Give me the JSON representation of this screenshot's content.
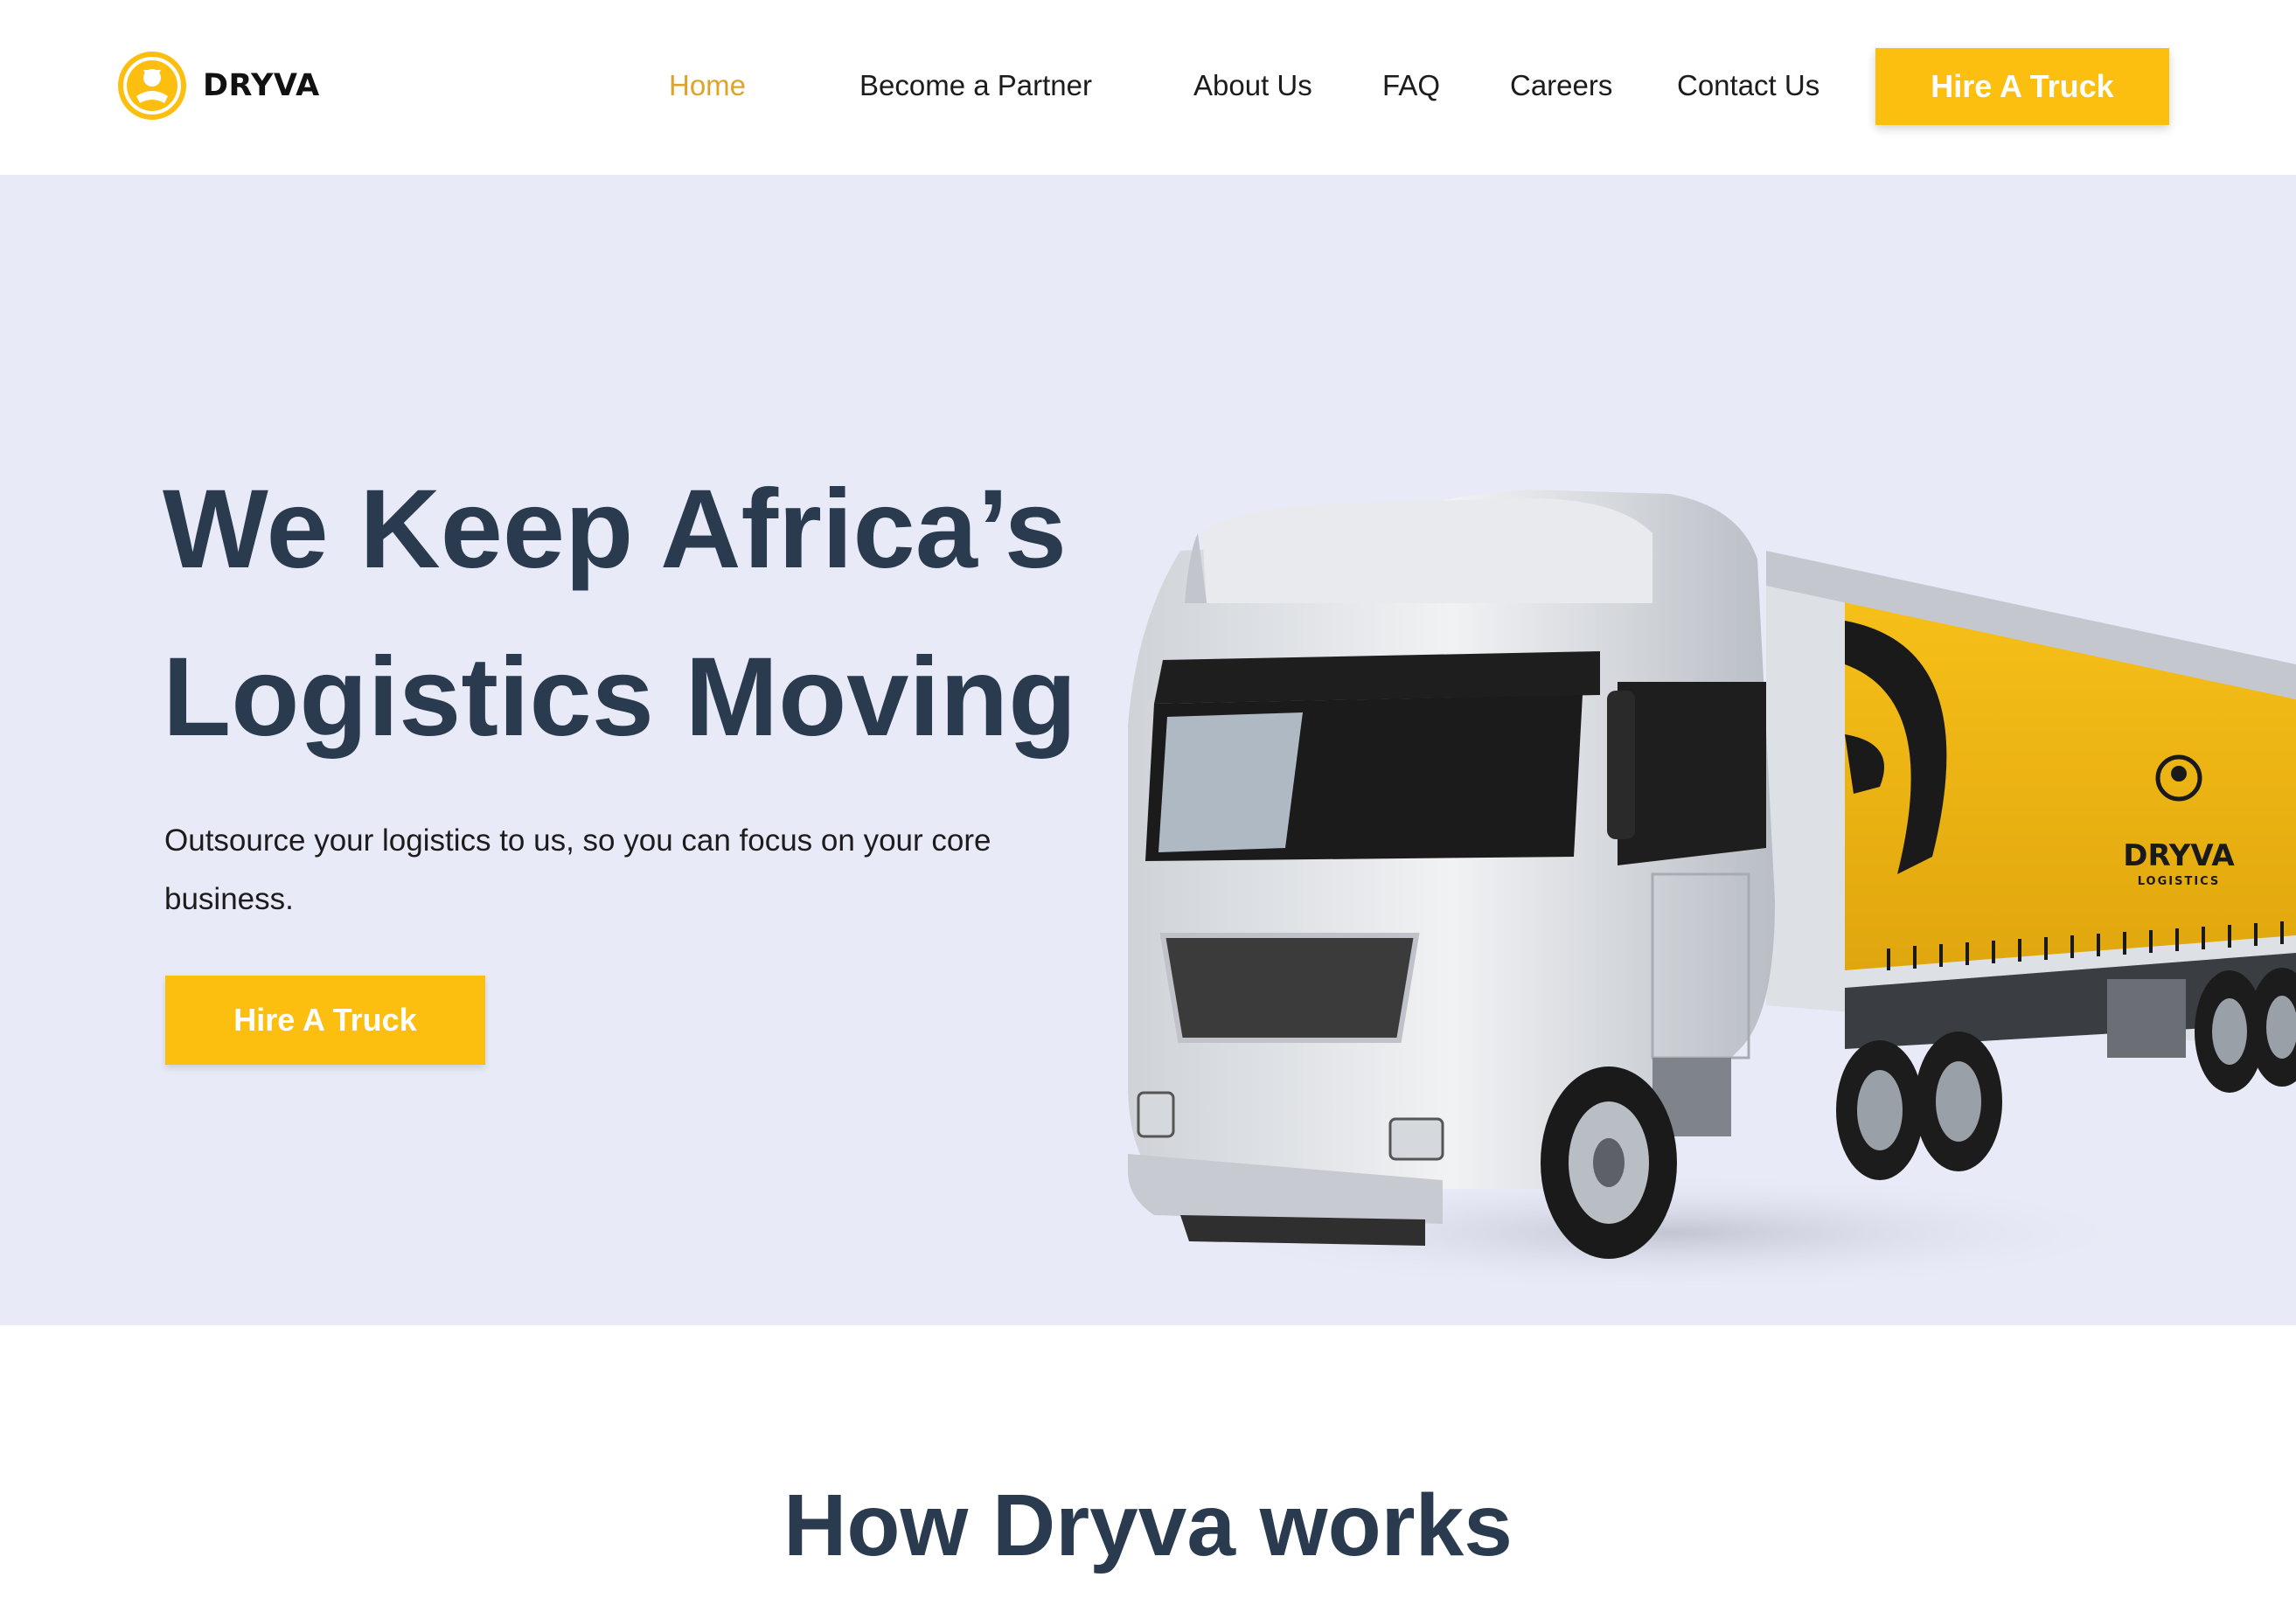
{
  "brand": {
    "name": "DRYVA",
    "logo_icon": "dryva-logo-icon"
  },
  "nav": {
    "links": [
      {
        "label": "Home",
        "active": true
      },
      {
        "label": "Become a Partner",
        "active": false
      },
      {
        "label": "About Us",
        "active": false
      },
      {
        "label": "FAQ",
        "active": false
      },
      {
        "label": "Careers",
        "active": false
      },
      {
        "label": "Contact Us",
        "active": false
      }
    ],
    "cta_label": "Hire A Truck"
  },
  "hero": {
    "title_line1": "We Keep Africa’s",
    "title_line2": "Logistics Moving",
    "subtitle": "Outsource your logistics to us, so you can focus on your core business.",
    "cta_label": "Hire A Truck",
    "truck_brand": "DRYVA",
    "truck_tagline": "LOGISTICS"
  },
  "how_it_works": {
    "title": "How Dryva works"
  },
  "colors": {
    "accent": "#fdbf0f",
    "active_link": "#e0a32a",
    "heading": "#2a3a4f",
    "hero_bg": "#e8ebf7"
  }
}
